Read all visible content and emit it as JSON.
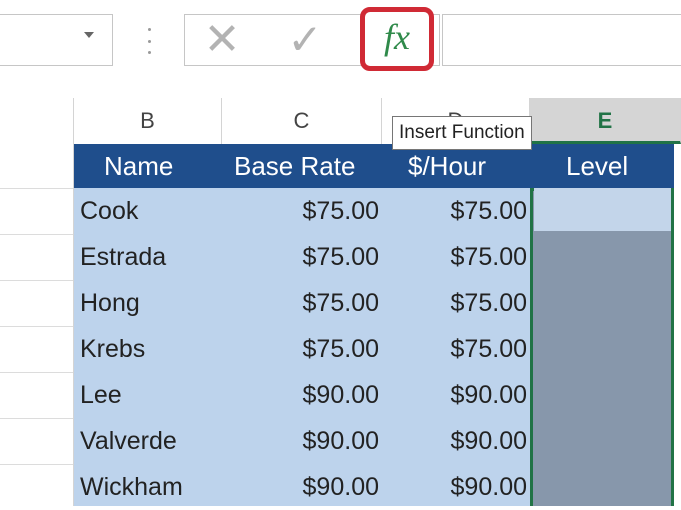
{
  "formula_bar": {
    "fx_label": "fx",
    "cancel_glyph": "✕",
    "enter_glyph": "✓",
    "tooltip": "Insert Function"
  },
  "column_headers": [
    {
      "label": "B",
      "selected": false
    },
    {
      "label": "C",
      "selected": false
    },
    {
      "label": "D",
      "selected": false
    },
    {
      "label": "E",
      "selected": true
    }
  ],
  "table": {
    "headers": [
      "Name",
      "Base Rate",
      "$/Hour",
      "Level"
    ],
    "rows": [
      {
        "name": "Cook",
        "base_rate": "$75.00",
        "per_hour": "$75.00"
      },
      {
        "name": "Estrada",
        "base_rate": "$75.00",
        "per_hour": "$75.00"
      },
      {
        "name": "Hong",
        "base_rate": "$75.00",
        "per_hour": "$75.00"
      },
      {
        "name": "Krebs",
        "base_rate": "$75.00",
        "per_hour": "$75.00"
      },
      {
        "name": "Lee",
        "base_rate": "$90.00",
        "per_hour": "$90.00"
      },
      {
        "name": "Valverde",
        "base_rate": "$90.00",
        "per_hour": "$90.00"
      },
      {
        "name": "Wickham",
        "base_rate": "$90.00",
        "per_hour": "$90.00"
      }
    ]
  },
  "colors": {
    "table_header": "#1f4e8c",
    "table_body": "#bdd3ec",
    "selection_border": "#217346",
    "fx_highlight": "#d02a35"
  }
}
